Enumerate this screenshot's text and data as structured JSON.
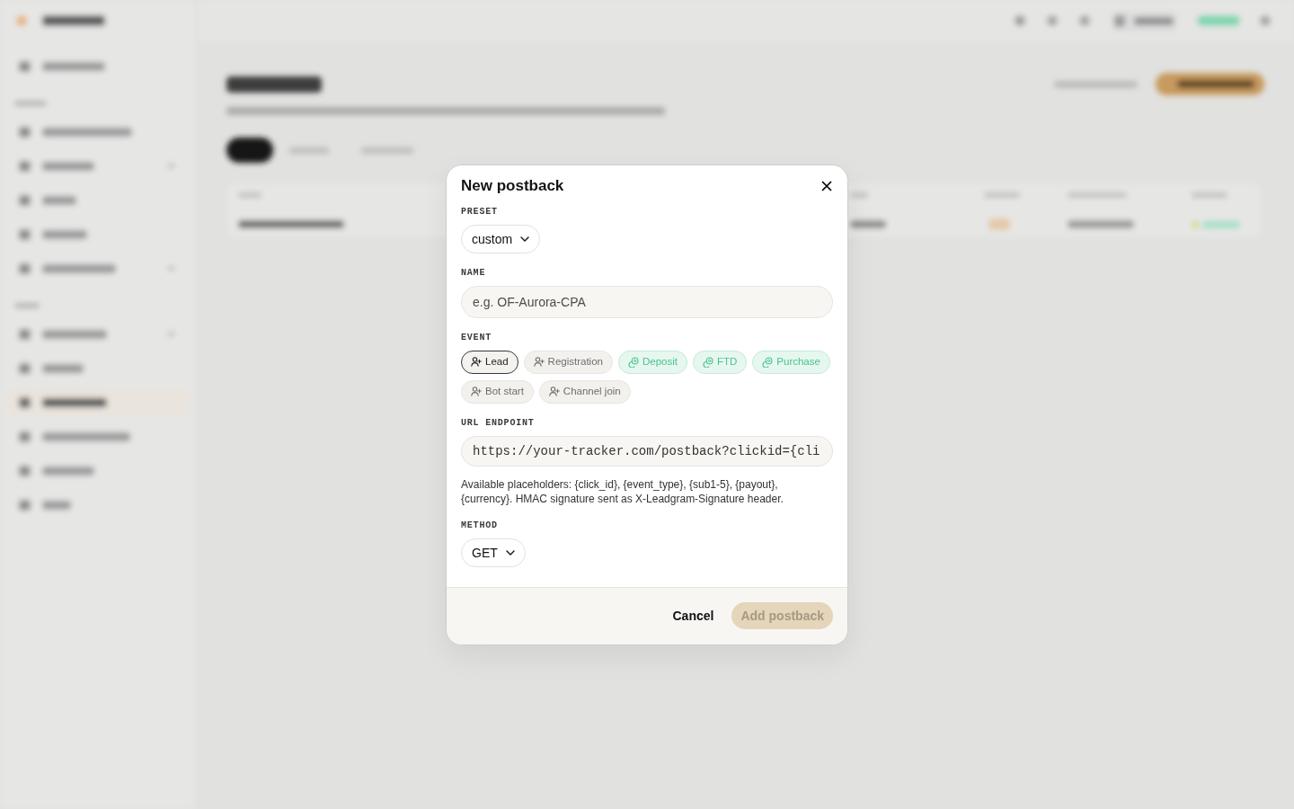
{
  "dialog": {
    "title": "New postback",
    "fields": [
      {
        "kind": "select",
        "label": "PRESET",
        "value": "custom"
      },
      {
        "kind": "text",
        "label": "NAME",
        "placeholder": "e.g. OF-Aurora-CPA"
      },
      {
        "kind": "chips",
        "label": "EVENT",
        "options": [
          {
            "label": "Lead",
            "kind": "signup",
            "selected": true
          },
          {
            "label": "Registration",
            "kind": "signup",
            "selected": false
          },
          {
            "label": "Deposit",
            "kind": "payment",
            "selected": false
          },
          {
            "label": "FTD",
            "kind": "payment",
            "selected": false
          },
          {
            "label": "Purchase",
            "kind": "payment",
            "selected": false
          },
          {
            "label": "Bot start",
            "kind": "signup",
            "selected": false
          },
          {
            "label": "Channel join",
            "kind": "signup",
            "selected": false
          }
        ]
      },
      {
        "kind": "url",
        "label": "URL ENDPOINT",
        "value": "https://your-tracker.com/postback?clickid={cli",
        "help": "Available placeholders: {click_id}, {event_type}, {sub1-5}, {payout}, {currency}. HMAC signature sent as X-Leadgram-Signature header."
      },
      {
        "kind": "select",
        "label": "METHOD",
        "value": "GET"
      }
    ],
    "buttons": [
      {
        "label": "Cancel",
        "kind": "secondary",
        "disabled": false
      },
      {
        "label": "Add postback",
        "kind": "primary",
        "disabled": true
      }
    ]
  }
}
